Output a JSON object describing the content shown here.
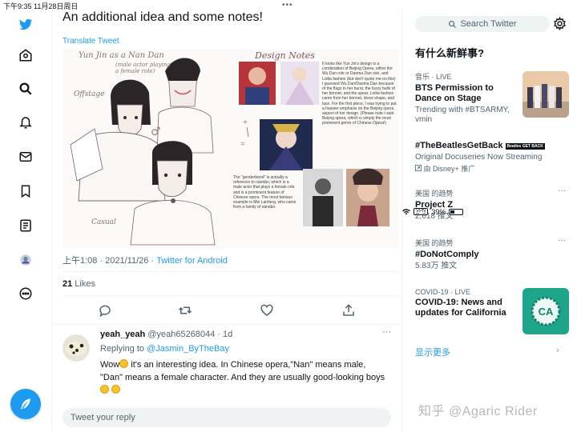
{
  "status_bar": {
    "time_date": "下午9:35   11月28日周日",
    "dots": "•••",
    "vpn": "VPN",
    "battery": "39%"
  },
  "nav": {
    "items": [
      "twitter-logo",
      "home",
      "explore",
      "notifications",
      "messages",
      "bookmarks",
      "lists",
      "profile",
      "more"
    ],
    "accent": "#1d9bf0"
  },
  "tweet": {
    "text": "An additional idea and some notes!",
    "translate": "Translate Tweet",
    "media": {
      "handwriting_top": "Yun Jin as a Nan Dan",
      "handwriting_top_sub": "(male actor playing a female role)",
      "handwriting_offstage": "Offstage",
      "handwriting_casual": "Casual",
      "design_notes_title": "Design Notes",
      "note_right": "It looks like Yun Jin's design is a combination of Beijing Opera, either the Wu Dan role or Daoma Dan role, and Lolita fashion (but don't quote me on this) I guessed Wu Dan/Daoma Dan because of the flags in her burst, the fuzzy balls of her bonnet, and the spear. Lolita fashion came from her bonnet, dress shape, and lace. For the first piece, I was trying to put a heavier emphasis on the Beijing opera aspect of her design. (Please note I said Beijing opera, which is simply the most prominent genre of Chinese Opera!)",
      "note_left": "The \"genderbend\" is actually a reference to nándàn, which is a male actor that plays a female role and is a prominent feature of Chinese opera. The most famous example is Mei Lanfang, who came from a family of nándàn."
    },
    "time": "上午1:08 · 2021/11/26 · ",
    "client": "Twitter for Android",
    "likes_count": "21",
    "likes_label": " Likes"
  },
  "reply": {
    "name": "yeah_yeah",
    "handle_time": " @yeah65268044 · 1d",
    "more": "···",
    "replying_label": "Replying to ",
    "replying_handle": "@Jasmin_ByTheBay",
    "body_1": "Wow",
    "body_2": " it's an interesting idea. In Chinese opera,\"Nan\" means male,  \"Dan\" means a female character. And they are usually good-looking boys",
    "composer_placeholder": "Tweet your reply"
  },
  "sidebar": {
    "search_placeholder": "Search Twitter",
    "title": "有什么新鲜事?",
    "trends": [
      {
        "meta": "音乐 · LIVE",
        "topic": "BTS Permission to Dance on Stage",
        "sub": "Trending with #BTSARMY, vmin"
      },
      {
        "meta": "",
        "topic": "#TheBeatlesGetBack",
        "badge": "Beatles GET BACK",
        "sub": "Original Docuseries Now Streaming",
        "promoted": "由 Disney+ 推广"
      },
      {
        "meta": "美国 的趋势",
        "topic": "Project Z",
        "sub": "2,618 推文",
        "more": "···"
      },
      {
        "meta": "美国 的趋势",
        "topic": "#DoNotComply",
        "sub": "5.83万 推文",
        "more": "···"
      },
      {
        "meta": "COVID-19 · LIVE",
        "topic": "COVID-19: News and updates for California",
        "sub": ""
      }
    ],
    "show_more": "显示更多",
    "watermark": "知乎 @Agaric Rider"
  }
}
